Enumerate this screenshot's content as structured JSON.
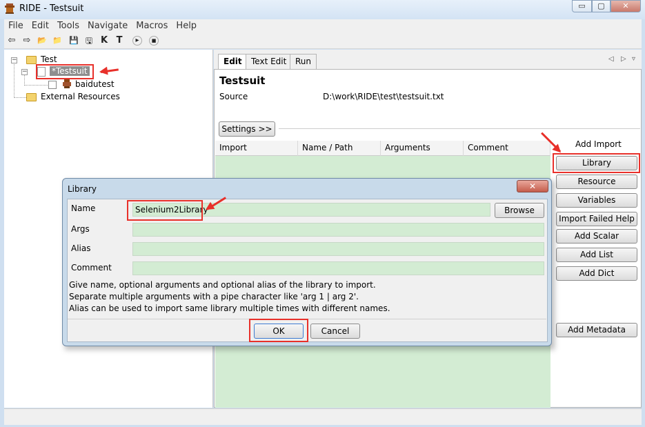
{
  "window": {
    "title": "RIDE - Testsuit",
    "min": "▭",
    "max": "▢",
    "close": "✕"
  },
  "menu": [
    "File",
    "Edit",
    "Tools",
    "Navigate",
    "Macros",
    "Help"
  ],
  "toolbar": {
    "back": "⇦",
    "forward": "⇨",
    "open": "📂",
    "open_dir": "📁",
    "save": "💾",
    "save_all": "🖫",
    "keyword": "K",
    "test": "T",
    "run": "▸",
    "stop": "■"
  },
  "tree": {
    "root": "Test",
    "suite": "*Testsuit",
    "test": "baidutest",
    "external": "External Resources"
  },
  "editor": {
    "tabs": [
      "Edit",
      "Text Edit",
      "Run"
    ],
    "nav_prev": "◁",
    "nav_next": "▷",
    "nav_down": "▿",
    "suite_title": "Testsuit",
    "source_label": "Source",
    "source_path": "D:\\work\\RIDE\\test\\testsuit.txt",
    "settings_button": "Settings >>",
    "grid_columns": [
      "Import",
      "Name / Path",
      "Arguments",
      "Comment"
    ],
    "add_import_label": "Add Import",
    "buttons": [
      "Library",
      "Resource",
      "Variables",
      "Import Failed Help",
      "Add Scalar",
      "Add List",
      "Add Dict"
    ],
    "add_metadata": "Add Metadata"
  },
  "dialog": {
    "title": "Library",
    "close": "✕",
    "name_label": "Name",
    "name_value": "Selenium2Library",
    "browse": "Browse",
    "args_label": "Args",
    "alias_label": "Alias",
    "comment_label": "Comment",
    "help_lines": [
      "Give name, optional arguments and optional alias of the library to import.",
      "Separate multiple arguments with a pipe character like 'arg 1 | arg 2'.",
      "Alias can be used to import same library multiple times with different names."
    ],
    "ok": "OK",
    "cancel": "Cancel"
  },
  "colors": {
    "annotation_red": "#e8302a",
    "field_green": "#d3ecd3"
  }
}
